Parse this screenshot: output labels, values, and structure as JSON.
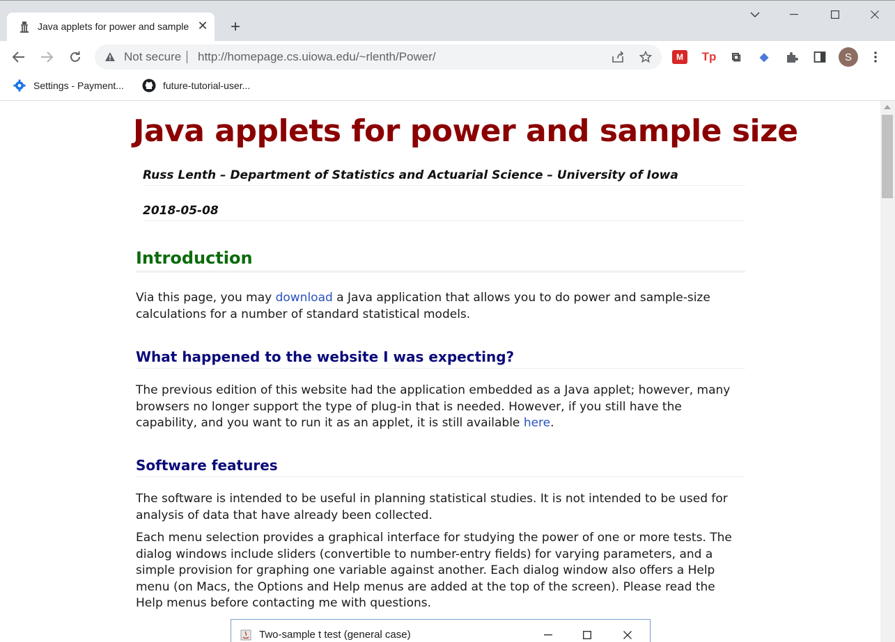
{
  "browser": {
    "tab": {
      "title": "Java applets for power and sample size",
      "close": "✕"
    },
    "new_tab": "+",
    "nav": {
      "back": "back",
      "forward": "forward",
      "reload": "reload"
    },
    "omnibox": {
      "security_label": "Not secure",
      "url": "http://homepage.cs.uiowa.edu/~rlenth/Power/"
    },
    "profile_initial": "S",
    "bookmarks": [
      {
        "label": "Settings - Payment...",
        "icon": "gear-icon"
      },
      {
        "label": "future-tutorial-user...",
        "icon": "github-icon"
      }
    ],
    "extensions": [
      {
        "name": "mendeley-extension",
        "glyph": "M",
        "color": "#d62828"
      },
      {
        "name": "tp-extension",
        "glyph": "Tp",
        "color": "#e53935"
      },
      {
        "name": "screencast-extension",
        "glyph": "⧉",
        "color": "#3c4043"
      },
      {
        "name": "scholar-extension",
        "glyph": "◆",
        "color": "#4a7bd8"
      },
      {
        "name": "puzzle-extension",
        "glyph": "✚",
        "color": "#5f6368"
      },
      {
        "name": "sidepanel-extension",
        "glyph": "▮",
        "color": "#3c4043"
      }
    ]
  },
  "page": {
    "title": "Java applets for power and sample size",
    "author": "Russ Lenth – Department of Statistics and Actuarial Science – University of Iowa",
    "date": "2018-05-08",
    "intro": {
      "heading": "Introduction",
      "text_before": "Via this page, you may ",
      "link": "download",
      "text_after": " a Java application that allows you to do power and sample-size calculations for a number of standard statistical models."
    },
    "website": {
      "heading": "What happened to the website I was expecting?",
      "text_before": "The previous edition of this website had the application embedded as a Java applet; however, many browsers no longer support the type of plug-in that is needed. However, if you still have the capability, and you want to run it as an applet, it is still available ",
      "link": "here",
      "text_after": "."
    },
    "features": {
      "heading": "Software features",
      "para1": "The software is intended to be useful in planning statistical studies. It is not intended to be used for analysis of data that have already been collected.",
      "para2": "Each menu selection provides a graphical interface for studying the power of one or more tests. The dialog windows include sliders (convertible to number-entry fields) for varying parameters, and a simple provision for graphing one variable against another. Each dialog window also offers a Help menu (on Macs, the Options and Help menus are added at the top of the screen). Please read the Help menus before contacting me with questions."
    },
    "applet_window": {
      "title": "Two-sample t test (general case)"
    }
  }
}
